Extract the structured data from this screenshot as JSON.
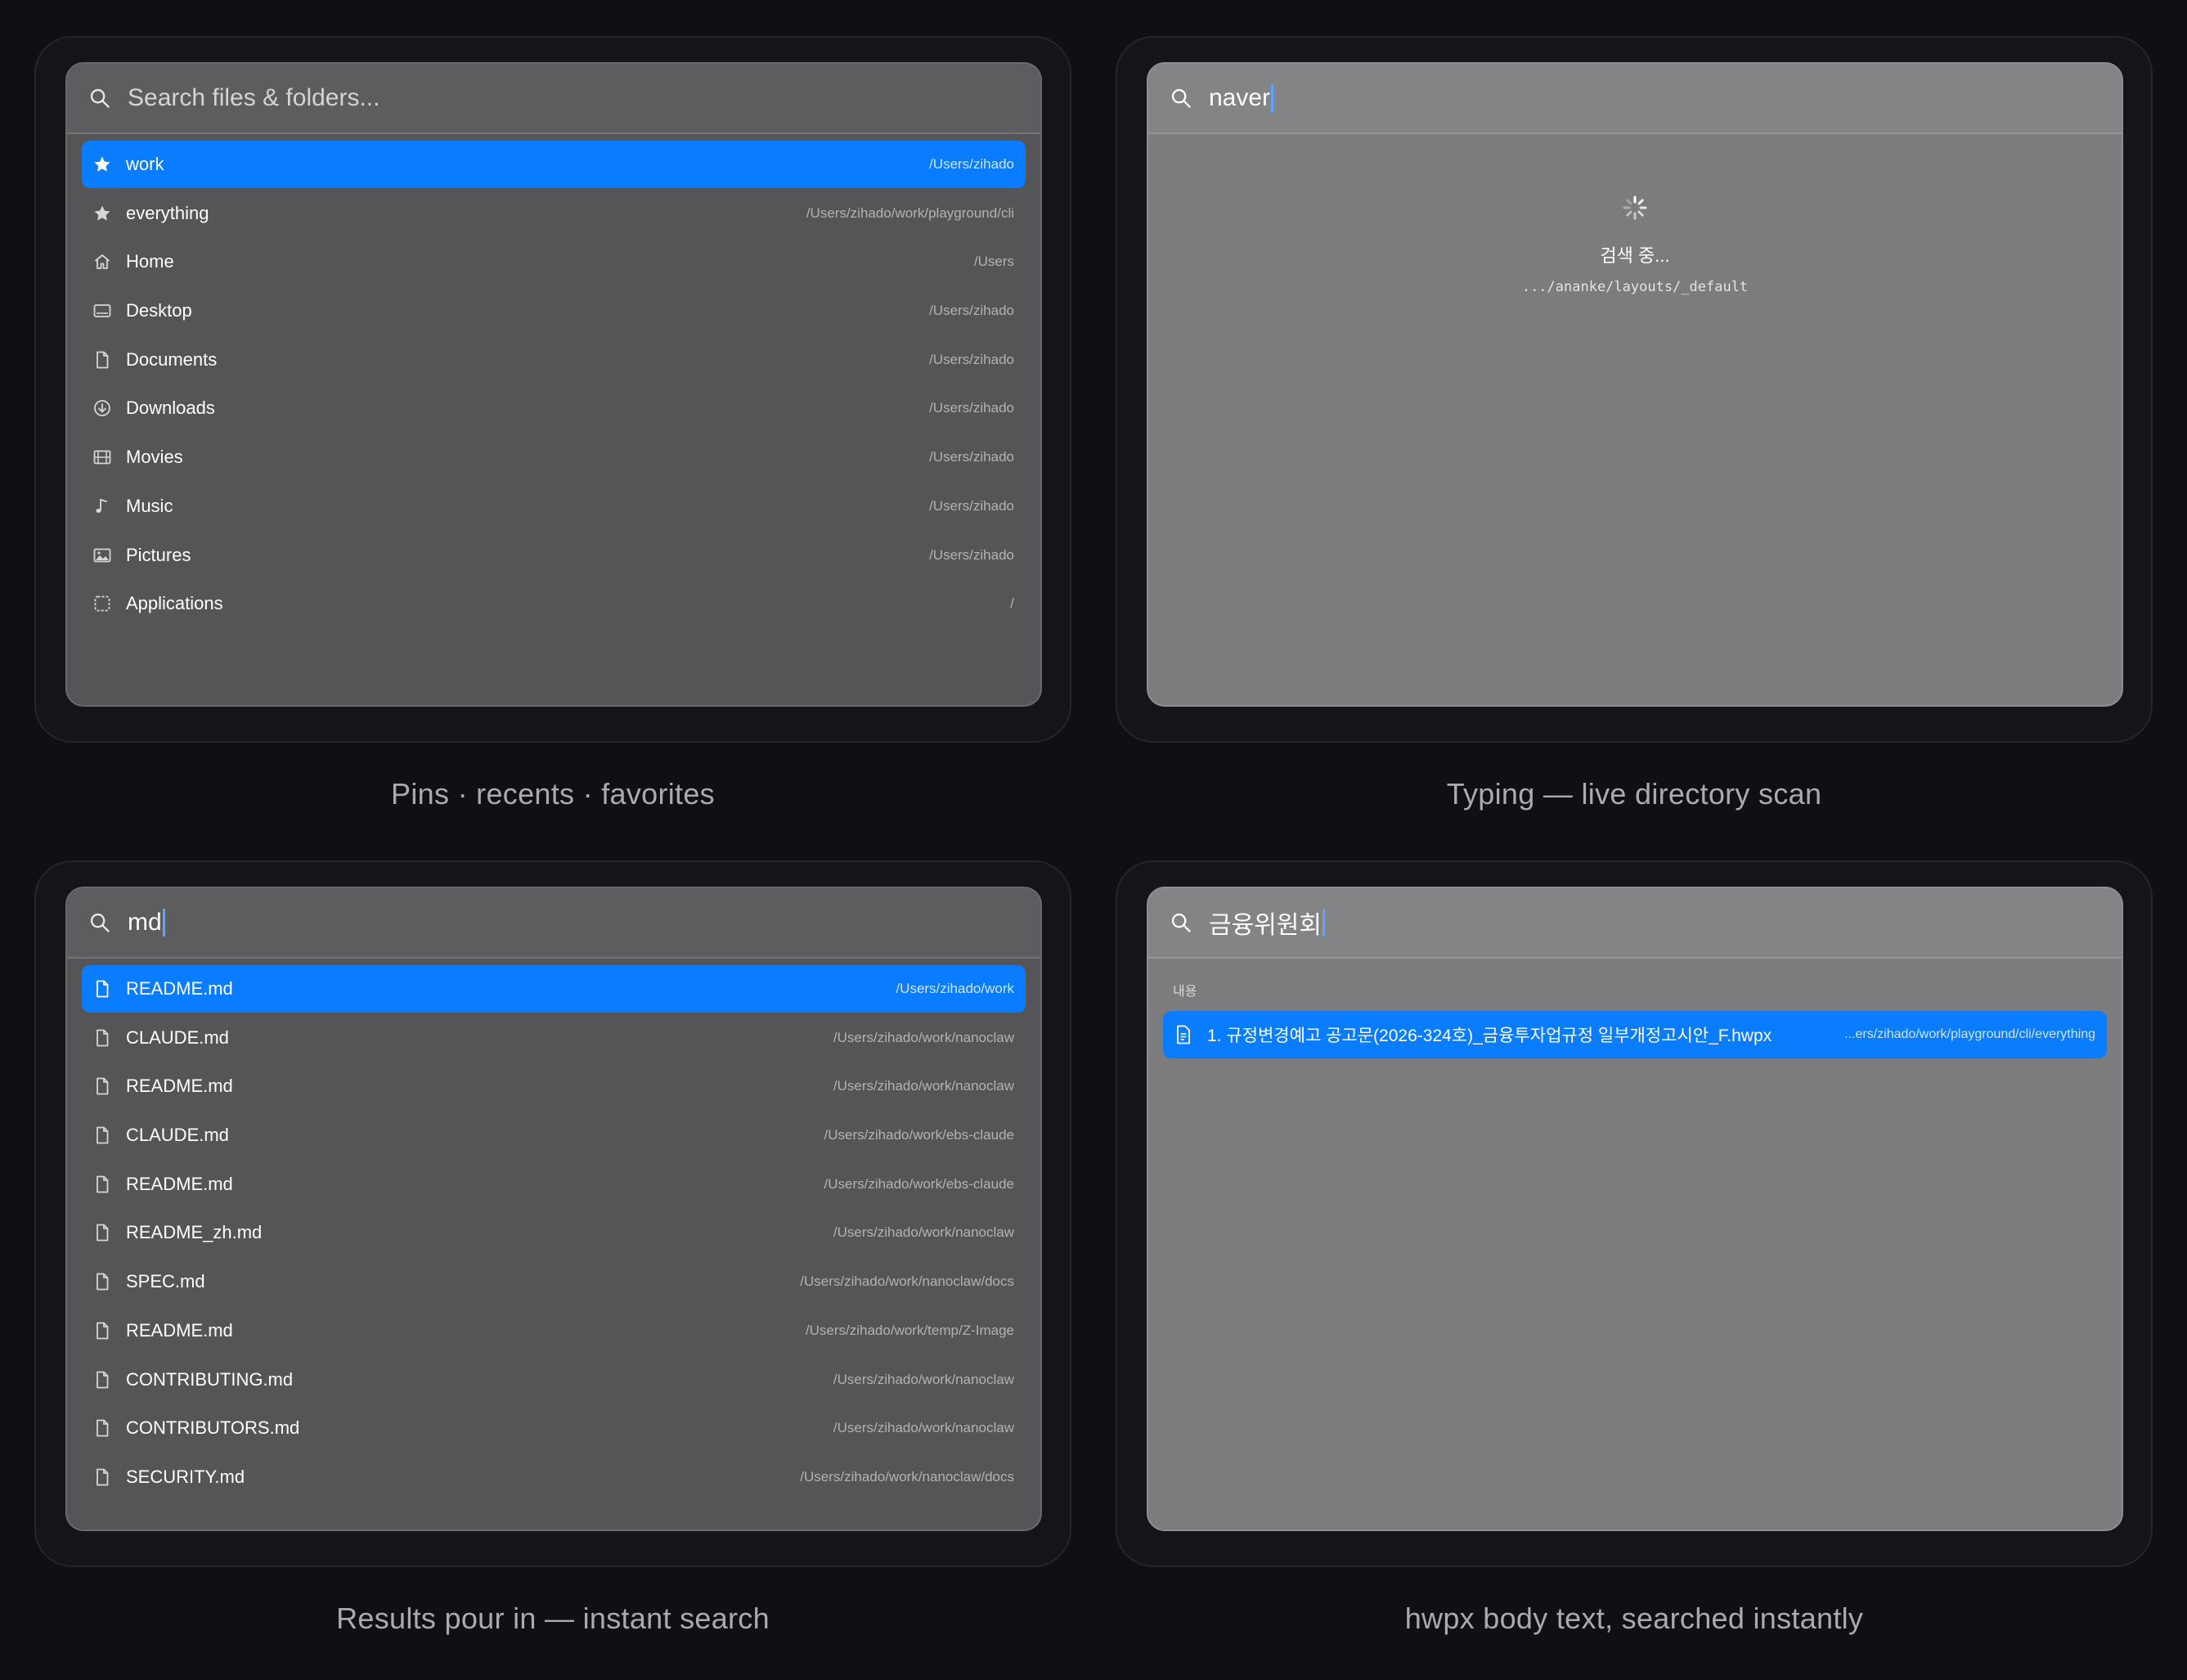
{
  "panels": {
    "pins": {
      "search_placeholder": "Search files & folders...",
      "caption": "Pins · recents · favorites",
      "items": [
        {
          "name": "work",
          "path": "/Users/zihado",
          "icon": "star-icon",
          "selected": true
        },
        {
          "name": "everything",
          "path": "/Users/zihado/work/playground/cli",
          "icon": "star-icon"
        },
        {
          "name": "Home",
          "path": "/Users",
          "icon": "home-icon"
        },
        {
          "name": "Desktop",
          "path": "/Users/zihado",
          "icon": "desktop-icon"
        },
        {
          "name": "Documents",
          "path": "/Users/zihado",
          "icon": "document-icon"
        },
        {
          "name": "Downloads",
          "path": "/Users/zihado",
          "icon": "download-icon"
        },
        {
          "name": "Movies",
          "path": "/Users/zihado",
          "icon": "film-icon"
        },
        {
          "name": "Music",
          "path": "/Users/zihado",
          "icon": "music-icon"
        },
        {
          "name": "Pictures",
          "path": "/Users/zihado",
          "icon": "picture-icon"
        },
        {
          "name": "Applications",
          "path": "/",
          "icon": "applications-icon"
        }
      ]
    },
    "typing": {
      "query": "naver",
      "status": "검색 중...",
      "scan_path": ".../ananke/layouts/_default",
      "caption": "Typing — live directory scan"
    },
    "results": {
      "query": "md",
      "caption": "Results pour in — instant search",
      "items": [
        {
          "name": "README.md",
          "path": "/Users/zihado/work",
          "selected": true
        },
        {
          "name": "CLAUDE.md",
          "path": "/Users/zihado/work/nanoclaw"
        },
        {
          "name": "README.md",
          "path": "/Users/zihado/work/nanoclaw"
        },
        {
          "name": "CLAUDE.md",
          "path": "/Users/zihado/work/ebs-claude"
        },
        {
          "name": "README.md",
          "path": "/Users/zihado/work/ebs-claude"
        },
        {
          "name": "README_zh.md",
          "path": "/Users/zihado/work/nanoclaw"
        },
        {
          "name": "SPEC.md",
          "path": "/Users/zihado/work/nanoclaw/docs"
        },
        {
          "name": "README.md",
          "path": "/Users/zihado/work/temp/Z-Image"
        },
        {
          "name": "CONTRIBUTING.md",
          "path": "/Users/zihado/work/nanoclaw"
        },
        {
          "name": "CONTRIBUTORS.md",
          "path": "/Users/zihado/work/nanoclaw"
        },
        {
          "name": "SECURITY.md",
          "path": "/Users/zihado/work/nanoclaw/docs"
        }
      ]
    },
    "hwpx": {
      "query": "금융위원회",
      "section_label": "내용",
      "result": {
        "name": "1. 규정변경예고 공고문(2026-324호)_금융투자업규정 일부개정고시안_F.hwpx",
        "path": "...ers/zihado/work/playground/cli/everything"
      },
      "caption": "hwpx body text, searched instantly"
    }
  },
  "colors": {
    "accent": "#0a7cff",
    "background": "#0f1013"
  }
}
